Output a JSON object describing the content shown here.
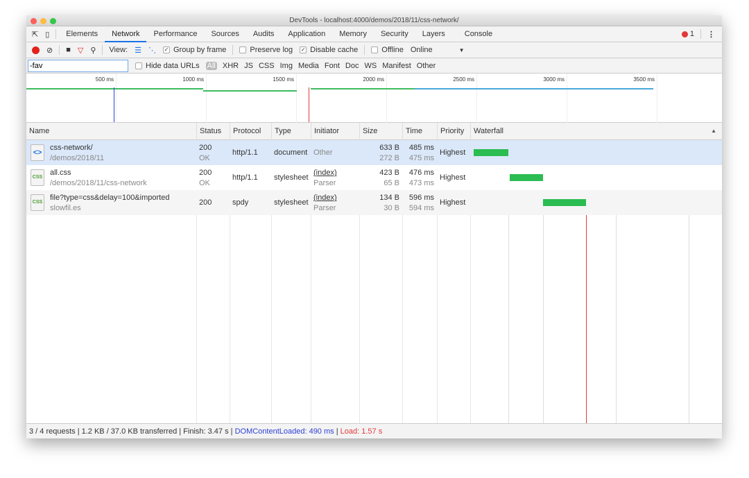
{
  "window": {
    "title": "DevTools - localhost:4000/demos/2018/11/css-network/"
  },
  "tabs": [
    {
      "label": "Elements"
    },
    {
      "label": "Network",
      "active": true
    },
    {
      "label": "Performance"
    },
    {
      "label": "Sources"
    },
    {
      "label": "Audits"
    },
    {
      "label": "Application"
    },
    {
      "label": "Memory"
    },
    {
      "label": "Security"
    },
    {
      "label": "Layers"
    },
    {
      "label": "Console"
    }
  ],
  "errors": {
    "count": "1",
    "icon": "error-icon"
  },
  "toolbar": {
    "view_label": "View:",
    "group_by_frame": "Group by frame",
    "group_by_frame_checked": true,
    "preserve_log": "Preserve log",
    "preserve_log_checked": false,
    "disable_cache": "Disable cache",
    "disable_cache_checked": true,
    "offline": "Offline",
    "offline_checked": false,
    "throttle": "Online"
  },
  "filter": {
    "value": "-fav",
    "hide_data_urls": "Hide data URLs",
    "types": [
      "All",
      "XHR",
      "JS",
      "CSS",
      "Img",
      "Media",
      "Font",
      "Doc",
      "WS",
      "Manifest",
      "Other"
    ],
    "active_type": "All"
  },
  "overview": {
    "ticks": [
      "500 ms",
      "1000 ms",
      "1500 ms",
      "2000 ms",
      "2500 ms",
      "3000 ms",
      "3500 ms"
    ],
    "dom_content_loaded_ms": 490,
    "load_ms": 1570
  },
  "columns": [
    "Name",
    "Status",
    "Protocol",
    "Type",
    "Initiator",
    "Size",
    "Time",
    "Priority",
    "Waterfall"
  ],
  "rows": [
    {
      "name": "css-network/",
      "path": "/demos/2018/11",
      "status": "200",
      "status_text": "OK",
      "protocol": "http/1.1",
      "type": "document",
      "initiator": "Other",
      "initiator_sub": "",
      "size": "633 B",
      "size_sub": "272 B",
      "time": "485 ms",
      "time_sub": "475 ms",
      "priority": "Highest",
      "icon": "document-icon",
      "selected": true
    },
    {
      "name": "all.css",
      "path": "/demos/2018/11/css-network",
      "status": "200",
      "status_text": "OK",
      "protocol": "http/1.1",
      "type": "stylesheet",
      "initiator": "(index)",
      "initiator_sub": "Parser",
      "size": "423 B",
      "size_sub": "65 B",
      "time": "476 ms",
      "time_sub": "473 ms",
      "priority": "Highest",
      "icon": "css-file-icon"
    },
    {
      "name": "file?type=css&delay=100&imported",
      "path": "slowfil.es",
      "status": "200",
      "status_text": "",
      "protocol": "spdy",
      "type": "stylesheet",
      "initiator": "(index)",
      "initiator_sub": "Parser",
      "size": "134 B",
      "size_sub": "30 B",
      "time": "596 ms",
      "time_sub": "594 ms",
      "priority": "Highest",
      "icon": "css-file-icon"
    }
  ],
  "statusbar": {
    "summary": "3 / 4 requests | 1.2 KB / 37.0 KB transferred | Finish: 3.47 s | ",
    "dcl": "DOMContentLoaded: 490 ms",
    "sep": " | ",
    "load": "Load: 1.57 s"
  },
  "colors": {
    "accent": "#1a73e8",
    "dcl": "#2d3fd6",
    "load": "#e2383a",
    "bar": "#2bbc52",
    "selected_row": "#dbe8f9"
  }
}
